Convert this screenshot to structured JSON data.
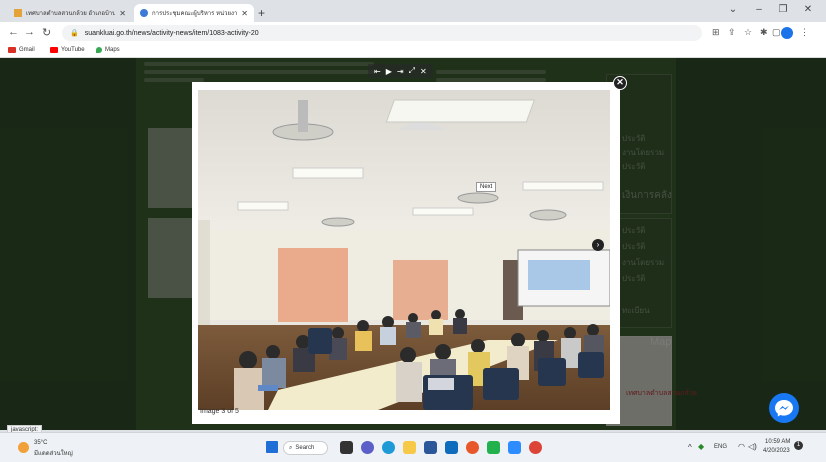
{
  "browser": {
    "tabs": [
      {
        "title": "เทศบาลตำบลสวนกล้วย อำเภอบ้านโป่ง",
        "active": false
      },
      {
        "title": "การประชุมคณะผู้บริหาร หน่วยงานเทศบาล",
        "active": true
      }
    ],
    "new_tab": "+",
    "window_controls": {
      "minimize": "–",
      "restore": "❐",
      "close": "✕",
      "menu": "⌄"
    },
    "address": "suankluai.go.th/news/activity-news/item/1083-activity-20",
    "bookmarks": [
      {
        "label": "Gmail",
        "color": "#d93025"
      },
      {
        "label": "YouTube",
        "color": "#ff0000"
      },
      {
        "label": "Maps",
        "color": "#34a853"
      }
    ]
  },
  "lightbox": {
    "caption": "Image 3 of 5",
    "next_tooltip": "Next",
    "close_glyph": "✕",
    "next_glyph": "›",
    "tools": [
      "⇤",
      "▶",
      "⇥",
      "⤢",
      "✕"
    ]
  },
  "page": {
    "sidebar_texts": [
      "ประวัติ",
      "งานโดยรวม",
      "ประวัติ",
      "เงินการคลัง",
      "ประวัติ",
      "ประวัติ",
      "งานโดยรวม",
      "ประวัติ",
      "ทะเบียน",
      "Map"
    ],
    "map_label": "เทศบาลตำบลสวนกล้วย"
  },
  "status_bar": "javascript:",
  "taskbar": {
    "weather_temp": "35°C",
    "weather_desc": "มีแดดส่วนใหญ่",
    "search_label": "Search",
    "tray_lang": "ENG",
    "time": "10:59 AM",
    "date": "4/20/2023"
  }
}
